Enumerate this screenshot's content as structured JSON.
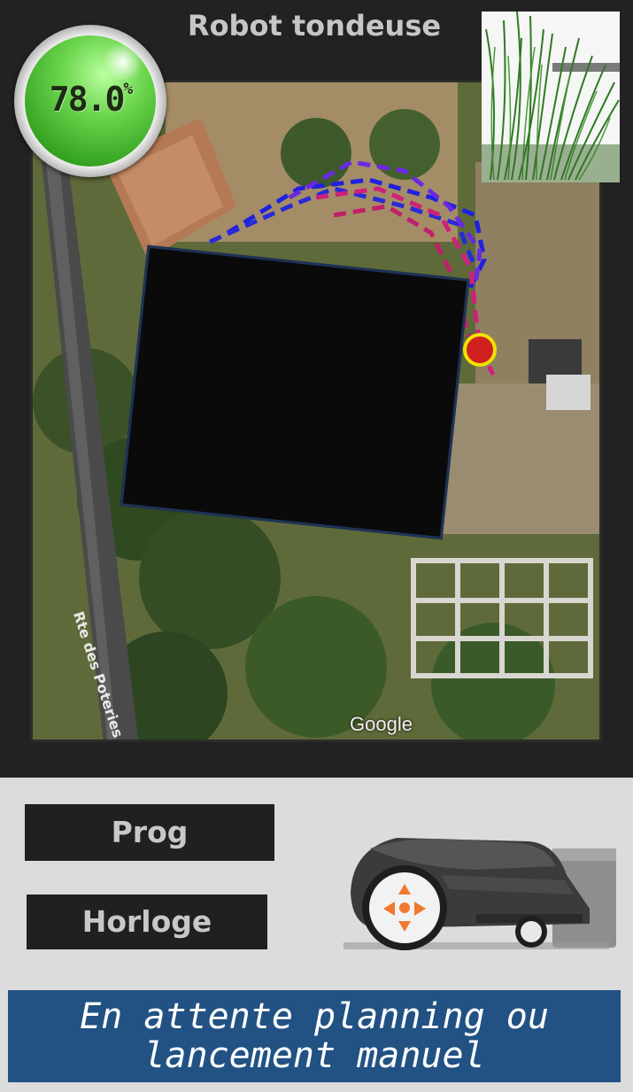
{
  "header": {
    "title": "Robot tondeuse"
  },
  "battery": {
    "value": "78.0",
    "unit": "%"
  },
  "map": {
    "attribution": "Google",
    "road_label": "Rte des Poteries"
  },
  "buttons": {
    "prog_label": "Prog",
    "horloge_label": "Horloge"
  },
  "status": {
    "line1": "En attente planning ou",
    "line2": "lancement manuel"
  },
  "icons": {
    "gauge": "battery-gauge-icon",
    "grass": "grass-icon",
    "mower": "robot-mower-icon",
    "marker": "mower-position-marker-icon"
  },
  "colors": {
    "status_bg": "#215283",
    "gauge_green": "#4cc132",
    "track_blue": "#2020e0",
    "track_magenta": "#d0207a",
    "marker_yellow": "#f2e200"
  }
}
